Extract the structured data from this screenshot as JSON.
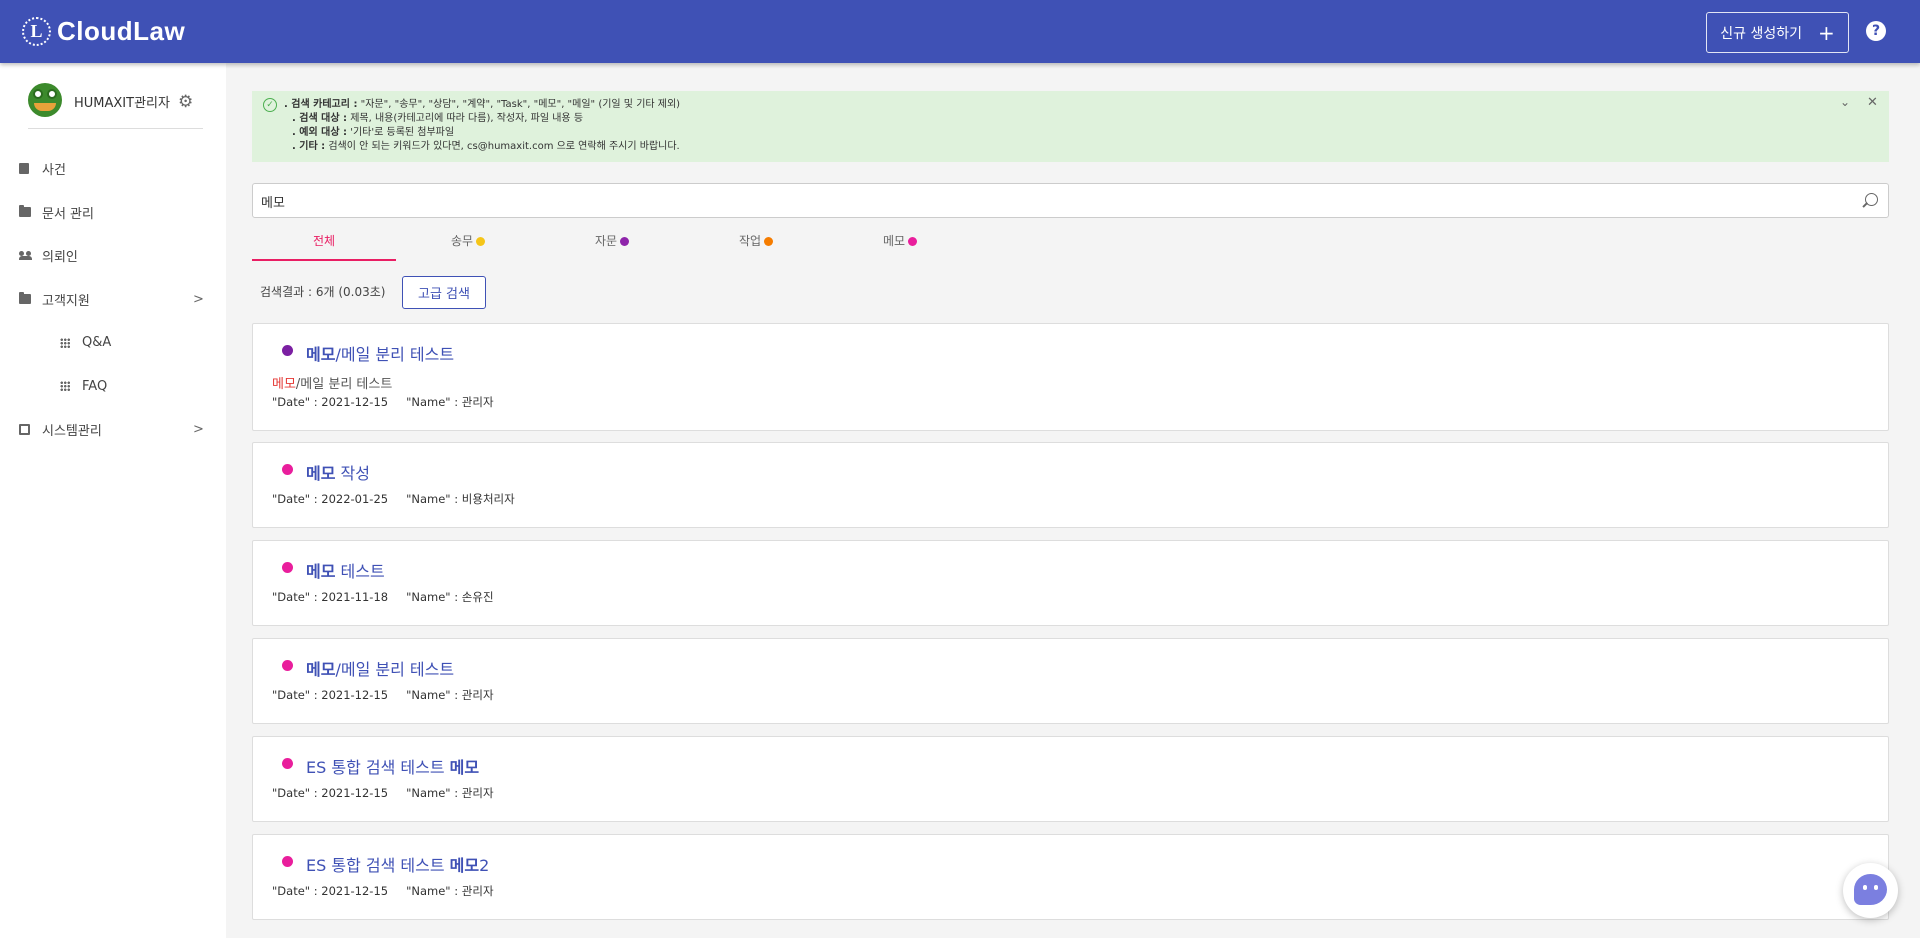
{
  "app": {
    "logo_text": "CloudLaw",
    "logo_letter": "L"
  },
  "header": {
    "new_button_label": "신규 생성하기",
    "new_button_plus": "+",
    "help_glyph": "?"
  },
  "sidebar": {
    "user_name": "HUMAXIT관리자",
    "items": [
      {
        "label": "사건",
        "icon": "book-icon"
      },
      {
        "label": "문서 관리",
        "icon": "folder-icon"
      },
      {
        "label": "의뢰인",
        "icon": "people-icon"
      },
      {
        "label": "고객지원",
        "icon": "folder-icon",
        "chevron": ">"
      },
      {
        "label": "Q&A",
        "icon": "grid-icon"
      },
      {
        "label": "FAQ",
        "icon": "grid-icon"
      },
      {
        "label": "시스템관리",
        "icon": "system-icon",
        "chevron": ">"
      }
    ]
  },
  "info": {
    "lines": [
      {
        "key": ". 검색 카테고리 :",
        "text": " \"자문\", \"송무\", \"상담\", \"계약\", \"Task\", \"메모\", \"메일\" (기일 및 기타 제외)"
      },
      {
        "key": ". 검색 대상 :",
        "text": " 제목, 내용(카테고리에 따라 다름), 작성자, 파일 내용 등"
      },
      {
        "key": ". 예외 대상 :",
        "text": " '기타'로 등록된 첨부파일"
      },
      {
        "key": ". 기타 :",
        "text": " 검색이 안 되는 키워드가 있다면, cs@humaxit.com 으로 연락해 주시기 바랍니다."
      }
    ]
  },
  "search": {
    "value": "메모"
  },
  "tabs": [
    {
      "label": "전체",
      "dot_color": "",
      "active": true
    },
    {
      "label": "송무",
      "dot_color": "#f5c518"
    },
    {
      "label": "자문",
      "dot_color": "#8e24aa"
    },
    {
      "label": "작업",
      "dot_color": "#f57c00"
    },
    {
      "label": "메모",
      "dot_color": "#e91e9c"
    }
  ],
  "results": {
    "count_text": "검색결과 : 6개 (0.03초)",
    "advanced_label": "고급 검색",
    "items": [
      {
        "dot_color": "#7b1fa2",
        "title_bold": "메모",
        "title_rest": "/메일 분리 테스트",
        "snippet_hl": "메모",
        "snippet_rest": "/메일 분리 테스트",
        "date": "\"Date\" : 2021-12-15",
        "name": "\"Name\" : 관리자"
      },
      {
        "dot_color": "#e91e9c",
        "title_bold": "메모",
        "title_rest": " 작성",
        "date": "\"Date\" : 2022-01-25",
        "name": "\"Name\" : 비용처리자"
      },
      {
        "dot_color": "#e91e9c",
        "title_bold": "메모",
        "title_rest": " 테스트",
        "date": "\"Date\" : 2021-11-18",
        "name": "\"Name\" : 손유진"
      },
      {
        "dot_color": "#e91e9c",
        "title_bold": "메모",
        "title_rest": "/메일 분리 테스트",
        "date": "\"Date\" : 2021-12-15",
        "name": "\"Name\" : 관리자"
      },
      {
        "dot_color": "#e91e9c",
        "title_pre": "ES 통합 검색 테스트 ",
        "title_bold": "메모",
        "date": "\"Date\" : 2021-12-15",
        "name": "\"Name\" : 관리자"
      },
      {
        "dot_color": "#e91e9c",
        "title_pre": "ES 통합 검색 테스트 ",
        "title_bold": "메모",
        "title_rest": "2",
        "date": "\"Date\" : 2021-12-15",
        "name": "\"Name\" : 관리자"
      }
    ]
  },
  "colors": {
    "header": "#3f51b5",
    "accent": "#e91e63",
    "info_bg": "#dff2dc"
  }
}
